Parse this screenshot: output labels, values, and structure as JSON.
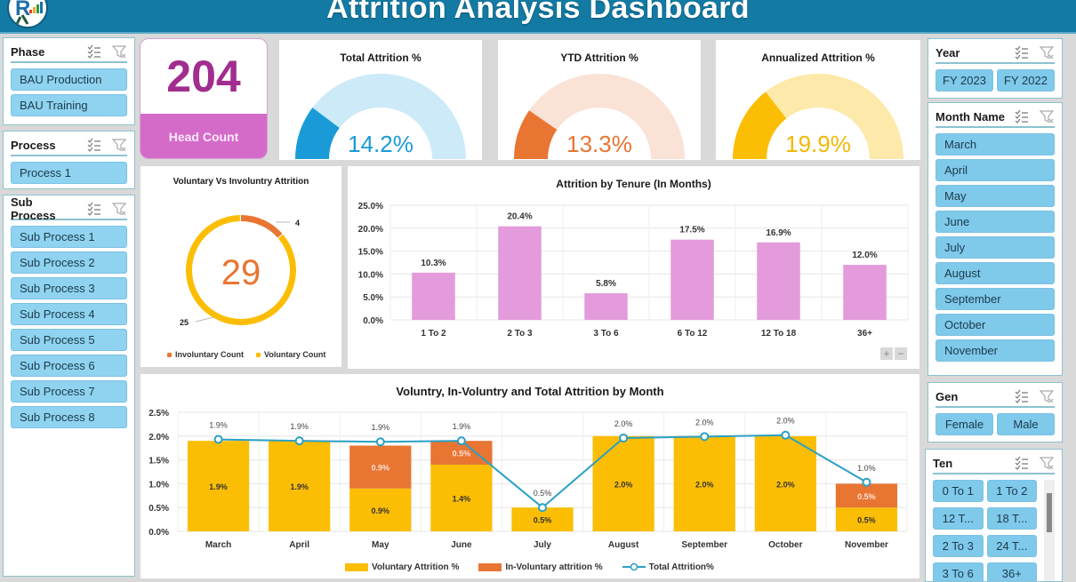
{
  "header": {
    "title": "Attrition Analysis Dashboard",
    "logo": "rk-logo"
  },
  "colors": {
    "header_bg": "#137aa3",
    "headcount": "#a12d8f",
    "headcount_label_bg": "#d56bc9",
    "total_gauge": "#1a9bd7",
    "total_gauge_bg": "#cdeaf8",
    "ytd_gauge": "#e87532",
    "ytd_gauge_bg": "#fbe2d6",
    "annual_gauge": "#fbbe05",
    "annual_gauge_bg": "#fde9a9",
    "voluntary": "#fbbe05",
    "involuntary": "#e87532",
    "total_line": "#2aa0c4",
    "tenure_bar": "#e39bdb",
    "slicer_item": "#8fd3f0"
  },
  "slicers": {
    "phase": {
      "title": "Phase",
      "items": [
        "BAU Production",
        "BAU Training"
      ]
    },
    "process": {
      "title": "Process",
      "items": [
        "Process 1"
      ]
    },
    "sub_process": {
      "title": "Sub Process",
      "items": [
        "Sub Process 1",
        "Sub Process 2",
        "Sub Process 3",
        "Sub Process 4",
        "Sub Process 5",
        "Sub Process 6",
        "Sub Process 7",
        "Sub Process 8"
      ]
    },
    "year": {
      "title": "Year",
      "items": [
        "FY 2023",
        "FY 2022"
      ]
    },
    "month": {
      "title": "Month Name",
      "items": [
        "March",
        "April",
        "May",
        "June",
        "July",
        "August",
        "September",
        "October",
        "November"
      ]
    },
    "gen": {
      "title": "Gen",
      "items": [
        "Female",
        "Male"
      ]
    },
    "ten": {
      "title": "Ten",
      "items": [
        "0 To 1",
        "1 To 2",
        "12 T...",
        "18 T...",
        "2 To 3",
        "24 T...",
        "3 To 6",
        "36+"
      ]
    }
  },
  "kpis": {
    "headcount": {
      "value": "204",
      "label": "Head Count"
    },
    "total_attrition": {
      "title": "Total Attrition %",
      "value": "14.2%",
      "fraction": 0.142
    },
    "ytd_attrition": {
      "title": "YTD Attrition %",
      "value": "13.3%",
      "fraction": 0.133
    },
    "annualized_attrition": {
      "title": "Annualized Attrition %",
      "value": "19.9%",
      "fraction": 0.199
    }
  },
  "chart_data": [
    {
      "type": "pie",
      "title": "Voluntary Vs Involuntry Attrition",
      "center_label": "29",
      "categories": [
        "Involuntary Count",
        "Voluntary Count"
      ],
      "values": [
        4,
        25
      ],
      "legend": "bottom"
    },
    {
      "type": "bar",
      "title": "Attrition by Tenure (In Months)",
      "categories": [
        "1 To 2",
        "2 To 3",
        "3 To 6",
        "6 To 12",
        "12 To 18",
        "36+"
      ],
      "values": [
        10.3,
        20.4,
        5.8,
        17.5,
        16.9,
        12.0
      ],
      "data_labels": [
        "10.3%",
        "20.4%",
        "5.8%",
        "17.5%",
        "16.9%",
        "12.0%"
      ],
      "yticks": [
        "0.0%",
        "5.0%",
        "10.0%",
        "15.0%",
        "20.0%",
        "25.0%"
      ],
      "ylim": [
        0,
        25
      ],
      "xlabel": "",
      "ylabel": "",
      "grid": true,
      "zoom_controls": [
        "+",
        "−"
      ]
    },
    {
      "type": "bar",
      "stacked": true,
      "title": "Voluntry, In-Voluntry and Total Attrition by Month",
      "categories": [
        "March",
        "April",
        "May",
        "June",
        "July",
        "August",
        "September",
        "October",
        "November"
      ],
      "series": [
        {
          "name": "Voluntary Attrition %",
          "kind": "bar",
          "values": [
            1.9,
            1.9,
            0.9,
            1.4,
            0.5,
            2.0,
            2.0,
            2.0,
            0.5
          ],
          "labels": [
            "1.9%",
            "1.9%",
            "0.9%",
            "1.4%",
            "0.5%",
            "2.0%",
            "2.0%",
            "2.0%",
            "0.5%"
          ]
        },
        {
          "name": "In-Voluntary attrition %",
          "kind": "bar",
          "values": [
            0,
            0,
            0.9,
            0.5,
            0,
            0,
            0,
            0,
            0.5
          ],
          "labels": [
            "",
            "",
            "0.9%",
            "0.5%",
            "",
            "",
            "",
            "",
            "0.5%"
          ]
        },
        {
          "name": "Total Attrition%",
          "kind": "line",
          "values": [
            1.93,
            1.9,
            1.88,
            1.9,
            0.5,
            1.96,
            1.99,
            2.02,
            1.03
          ],
          "labels": [
            "1.9%",
            "1.9%",
            "1.9%",
            "1.9%",
            "0.5%",
            "2.0%",
            "2.0%",
            "2.0%",
            "1.0%"
          ]
        }
      ],
      "yticks": [
        "0.0%",
        "0.5%",
        "1.0%",
        "1.5%",
        "2.0%",
        "2.5%"
      ],
      "ylim": [
        0,
        2.5
      ],
      "xlabel": "",
      "ylabel": "",
      "grid": true,
      "legend": "bottom"
    }
  ]
}
